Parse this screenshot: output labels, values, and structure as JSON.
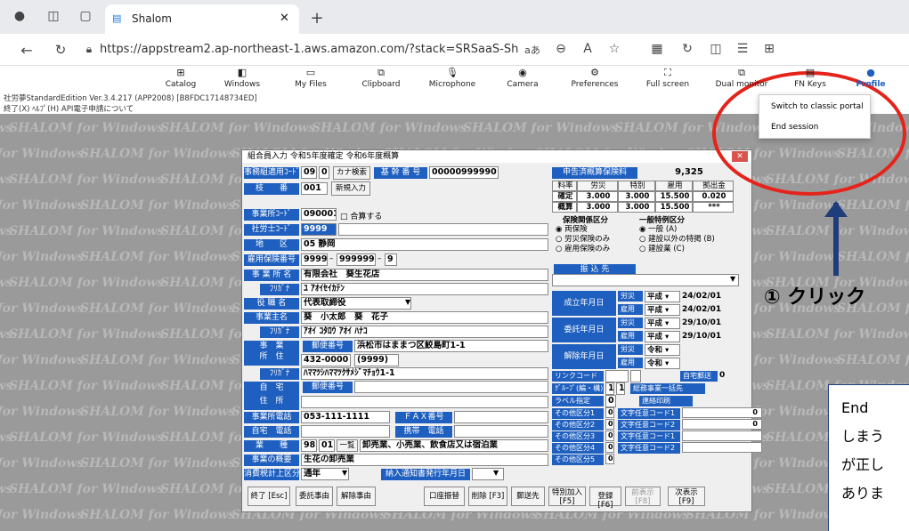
{
  "browser": {
    "tab_title": "Shalom",
    "url": "https://appstream2.ap-northeast-1.aws.amazon.com/?stack=SRSaaS-Shizuoka#/streamin..."
  },
  "appstream_toolbar": [
    {
      "label": "Catalog",
      "icon": "catalog-icon"
    },
    {
      "label": "Windows",
      "icon": "windows-icon"
    },
    {
      "label": "My Files",
      "icon": "folder-icon"
    },
    {
      "label": "Clipboard",
      "icon": "clipboard-icon"
    },
    {
      "label": "Microphone",
      "icon": "microphone-icon"
    },
    {
      "label": "Camera",
      "icon": "camera-icon"
    },
    {
      "label": "Preferences",
      "icon": "gear-icon"
    },
    {
      "label": "Full screen",
      "icon": "fullscreen-icon"
    },
    {
      "label": "Dual monitor",
      "icon": "dual-monitor-icon"
    },
    {
      "label": "FN Keys",
      "icon": "keyboard-icon"
    },
    {
      "label": "Profile",
      "icon": "user-icon"
    }
  ],
  "profile_menu": [
    "Switch to classic portal",
    "End session"
  ],
  "app": {
    "title": "社労夢StandardEdition  Ver.3.4.217 (APP2008) [B8FDC17148734ED]",
    "menu": "終了(X)  ﾍﾙﾌﾟ(H)  API電子申請について",
    "watermark": "SHALOM for Windows"
  },
  "dialog": {
    "title": "組合員入力  令和5年度確定 令和6年度概算",
    "labels": {
      "jigyo_code": "事務組適用ｺｰﾄﾞ",
      "kana_search": "カナ検索",
      "kikan_bango": "基 幹 番 号",
      "edaban": "枝　　番",
      "shinki": "新規入力",
      "jigyosho_code": "事業所ｺｰﾄﾞ",
      "gassan": "合算する",
      "sharoshi_code": "社労士ｺｰﾄﾞ",
      "chiku": "地　　区",
      "koyo_bango": "雇用保険番号",
      "jigyosho_mei": "事 業 所 名",
      "furigana": "ﾌﾘｶﾞﾅ",
      "yakushoku": "役 職 名",
      "jigyonushi": "事業主名",
      "jigyo_jusho": "事　業\n所　住",
      "yubin": "郵便番号",
      "jitaku": "自　宅\n住　所",
      "denwa": "事業所電話",
      "fax": "ＦＡＸ番号",
      "jitaku_denwa": "自宅　電話",
      "keitai": "携帯　電話",
      "gyoshu": "業　　種",
      "ichiran": "一覧",
      "gaiyo": "事業の概要",
      "shohi": "消費税計上区分",
      "nofu": "納入通知書発行年月日",
      "shinkoku": "申告済概算保険料",
      "hoken": "保険関係区分",
      "tokurei": "一般特例区分",
      "furikomi": "振 込 先",
      "seiritsu": "成立年月日",
      "itaku": "委託年月日",
      "kaijo": "解除年月日",
      "link": "リンクコード",
      "jitakuso": "自宅郵送",
      "kumiai": "ｸﾞﾙｰﾌﾟ(編・構)",
      "sogo": "総務事業一括先",
      "label_kokan": "ラベル指定",
      "renraku": "連絡印刷"
    },
    "values": {
      "jigyo_code1": "09",
      "jigyo_code2": "0",
      "kikan_bango": "00000999990",
      "edaban": "001",
      "jigyosho_code": "090001",
      "sharoshi_code": "9999",
      "chiku": "05 静岡",
      "koyo1": "9999",
      "koyo2": "999999",
      "koyo3": "9",
      "jigyosho_mei": "有限会社　葵生花店",
      "furigana1": "ﾕ ｱｵｲｾｲｶﾃﾝ",
      "yakushoku": "代表取締役",
      "jigyonushi": "葵　小太郎　葵　花子",
      "furigana2": "ｱｵｲ ｺﾀﾛｳ ｱｵｲ ﾊﾅｺ",
      "jusho": "浜松市はままつ区鮫島町1-1",
      "yubin": "432-0000",
      "yubin2": "(9999)",
      "furigana3": "ﾊﾏﾏﾂｼﾊﾏﾏﾂｸｻﾒｼﾞﾏﾁｮｳ1-1",
      "denwa": "053-111-1111",
      "gyoshu1": "98",
      "gyoshu2": "01",
      "gyoshu_text": "卸売業、小売業、飲食店又は宿泊業",
      "gaiyo": "生花の卸売業",
      "shohi": "通年",
      "shinkoku": "9,325",
      "jigyo_seiritsu_era": "平成",
      "jigyo_seiritsu": "24/02/01",
      "koyo_seiritsu_era": "平成",
      "koyo_seiritsu": "24/02/01",
      "rosai_itaku_era": "平成",
      "rosai_itaku": "29/10/01",
      "koyo_itaku_era": "平成",
      "koyo_itaku": "29/10/01",
      "rosai_kaijo_era": "令和",
      "koyo_kaijo_era": "令和",
      "link_zero": "0",
      "kumiai1": "1",
      "kumiai2": "1",
      "label_zero": "0"
    },
    "rate_table": {
      "headers": [
        "料率",
        "労災",
        "特別",
        "雇用",
        "拠出金"
      ],
      "rows": [
        [
          "確定",
          "3.000",
          "3.000",
          "15.500",
          "0.020"
        ],
        [
          "概算",
          "3.000",
          "3.000",
          "15.500",
          "***"
        ]
      ]
    },
    "hoken_options": [
      "両保険",
      "労災保険のみ",
      "雇用保険のみ"
    ],
    "tokurei_options": [
      "一般 (A)",
      "建設以外の特掲 (B)",
      "建設業 (C)"
    ],
    "nendo_labels": [
      "労災",
      "雇用"
    ],
    "other_rows": [
      "その他区分1",
      "その他区分2",
      "その他区分3",
      "その他区分4",
      "その他区分5"
    ],
    "other_values": [
      "0",
      "0",
      "0",
      "0",
      "0"
    ],
    "free_rows": [
      "文字任意コード1",
      "文字任意コード2",
      "文字任意コード1",
      "文字任意コード2"
    ],
    "free_values": [
      "0",
      "0"
    ],
    "buttons": [
      "終了 [Esc]",
      "委託事由",
      "解除事由",
      "口座振替",
      "削除 [F3]",
      "郵送先",
      "特別加入\n[F5]",
      "登録 [F6]",
      "前表示\n[F8]",
      "次表示\n[F9]"
    ]
  },
  "annotations": {
    "click": "① クリック",
    "note_lines": [
      "End",
      "しまう",
      "が正し",
      "ありま"
    ]
  }
}
